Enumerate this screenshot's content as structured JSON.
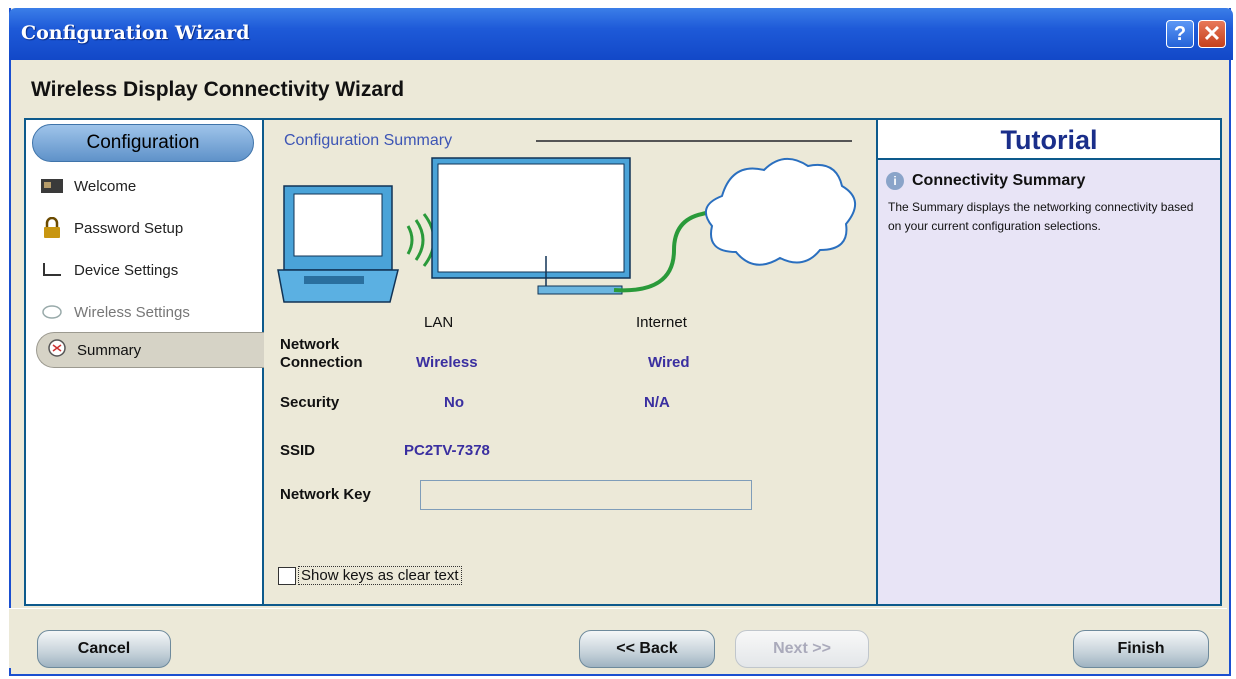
{
  "window": {
    "title": "Configuration Wizard",
    "help_label": "?",
    "close_label": "✕"
  },
  "wizard_title": "Wireless Display Connectivity Wizard",
  "sidebar": {
    "header": "Configuration",
    "items": [
      {
        "label": "Welcome",
        "icon": "monitor-icon",
        "disabled": false
      },
      {
        "label": "Password Setup",
        "icon": "lock-icon",
        "disabled": false
      },
      {
        "label": "Device Settings",
        "icon": "device-settings-icon",
        "disabled": false
      },
      {
        "label": "Wireless Settings",
        "icon": "wireless-icon",
        "disabled": true
      },
      {
        "label": "Summary",
        "icon": "summary-icon",
        "active": true
      }
    ]
  },
  "summary": {
    "title": "Configuration Summary",
    "columns": {
      "lan": "LAN",
      "internet": "Internet"
    },
    "network_connection": {
      "label_line1": "Network",
      "label_line2": "Connection",
      "lan": "Wireless",
      "internet": "Wired"
    },
    "security": {
      "label": "Security",
      "lan": "No",
      "internet": "N/A"
    },
    "ssid": {
      "label": "SSID",
      "value": "PC2TV-7378"
    },
    "network_key": {
      "label": "Network Key",
      "value": ""
    },
    "show_keys": {
      "label": "Show keys as clear text",
      "checked": false
    }
  },
  "tutorial": {
    "header": "Tutorial",
    "subtitle": "Connectivity Summary",
    "text": "The Summary displays the networking connectivity based on your current configuration selections."
  },
  "buttons": {
    "cancel": "Cancel",
    "back": "<< Back",
    "next": "Next >>",
    "finish": "Finish"
  },
  "colors": {
    "accent": "#1e5ad8",
    "panel_border": "#0d5a8c",
    "value_text": "#3a2fa0",
    "tutorial_bg": "#e8e4f6"
  }
}
